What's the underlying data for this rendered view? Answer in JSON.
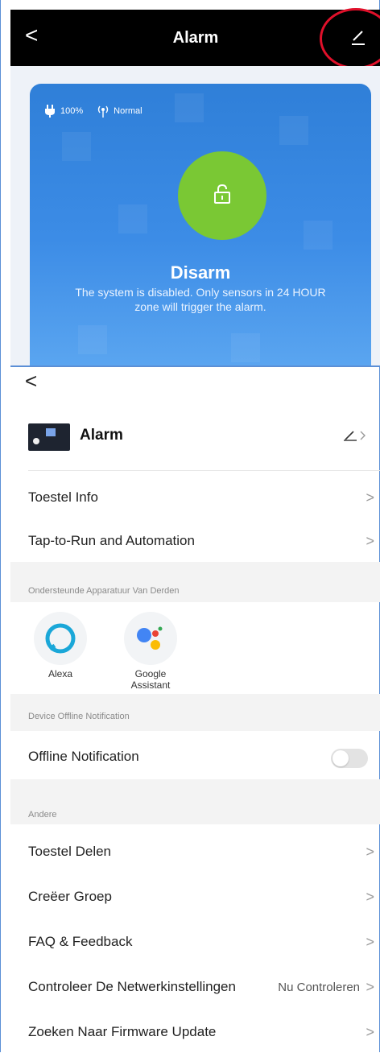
{
  "header": {
    "back": "<",
    "title": "Alarm"
  },
  "panel": {
    "battery": "100%",
    "signal": "Normal",
    "state_title": "Disarm",
    "state_desc": "The system is disabled. Only sensors in 24 HOUR zone will trigger the alarm."
  },
  "settings": {
    "back": "<",
    "device_name": "Alarm",
    "rows_top": [
      {
        "label": "Toestel Info",
        "chevron": ">"
      },
      {
        "label": "Tap-to-Run and Automation",
        "chevron": ">"
      }
    ],
    "third_party_header": "Ondersteunde Apparatuur Van Derden",
    "third_party": [
      {
        "name": "Alexa",
        "icon": "alexa-icon"
      },
      {
        "name": "Google Assistant",
        "icon": "google-assistant-icon"
      }
    ],
    "offline_header": "Device Offline Notification",
    "offline_label": "Offline Notification",
    "offline_enabled": false,
    "other_header": "Andere",
    "rows_other": [
      {
        "label": "Toestel Delen",
        "chevron": ">"
      },
      {
        "label": "Creëer Groep",
        "chevron": ">"
      },
      {
        "label": "FAQ & Feedback",
        "chevron": ">"
      },
      {
        "label": "Controleer De Netwerkinstellingen",
        "extra": "Nu Controleren",
        "chevron": ">"
      },
      {
        "label": "Zoeken Naar Firmware Update",
        "chevron": ">"
      }
    ]
  },
  "colors": {
    "accent_highlight": "#e0102a",
    "disarm_green": "#7ac834",
    "panel_blue": "#3c8ce6"
  }
}
